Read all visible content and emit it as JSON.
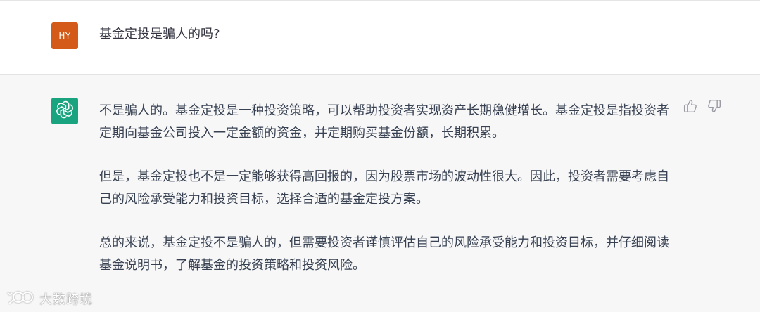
{
  "user_message": {
    "avatar_initials": "HY",
    "avatar_color": "#d35a18",
    "text": "基金定投是骗人的吗?"
  },
  "assistant_message": {
    "avatar_icon": "openai-logo-icon",
    "avatar_color": "#19a37f",
    "paragraphs": [
      "不是骗人的。基金定投是一种投资策略，可以帮助投资者实现资产长期稳健增长。基金定投是指投资者定期向基金公司投入一定金额的资金，并定期购买基金份额，长期积累。",
      "但是，基金定投也不是一定能够获得高回报的，因为股票市场的波动性很大。因此，投资者需要考虑自己的风险承受能力和投资目标，选择合适的基金定投方案。",
      "总的来说，基金定投不是骗人的，但需要投资者谨慎评估自己的风险承受能力和投资目标，并仔细阅读基金说明书，了解基金的投资策略和投资风险。"
    ],
    "feedback_icons": [
      "thumbs-up-icon",
      "thumbs-down-icon"
    ]
  },
  "watermark": {
    "text": "大数跨境",
    "icon": "watermark-logo-icon"
  }
}
